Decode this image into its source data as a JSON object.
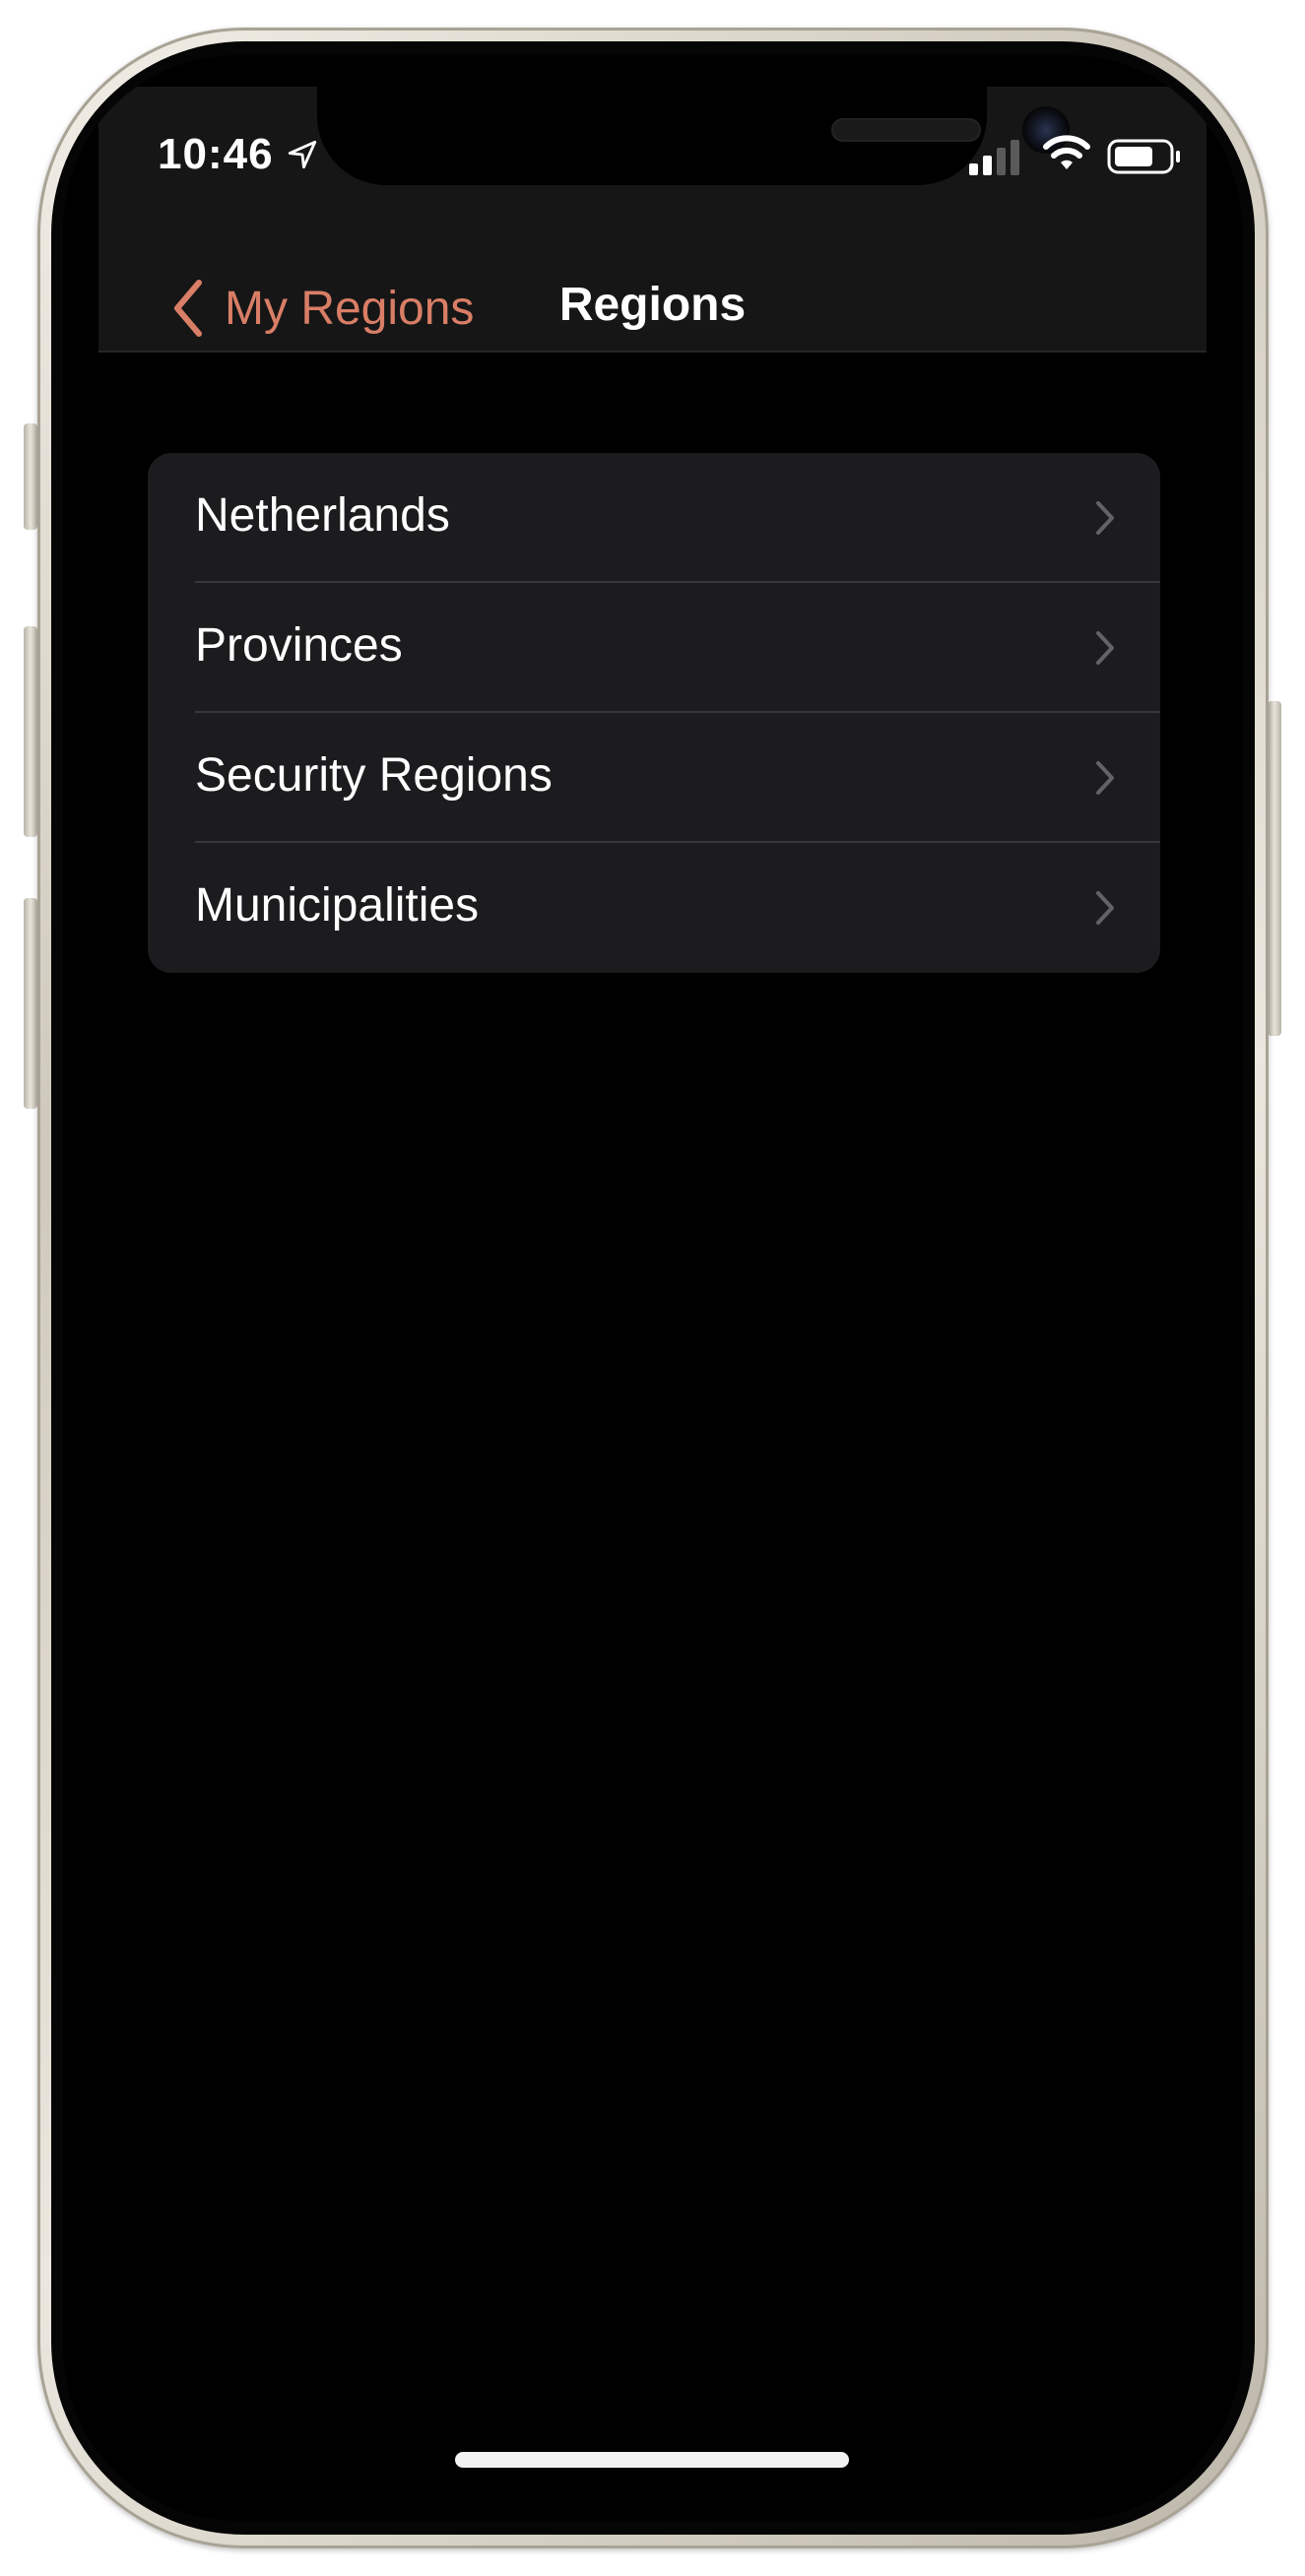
{
  "status_bar": {
    "time": "10:46",
    "icons": [
      "location-arrow-icon",
      "cellular-signal-icon",
      "wifi-icon",
      "battery-icon"
    ]
  },
  "nav": {
    "back_label": "My Regions",
    "title": "Regions"
  },
  "list": {
    "items": [
      {
        "label": "Netherlands"
      },
      {
        "label": "Provinces"
      },
      {
        "label": "Security Regions"
      },
      {
        "label": "Municipalities"
      }
    ]
  },
  "colors": {
    "accent": "#d97e66",
    "background": "#000000",
    "card": "#1c1c1e",
    "separator": "#38383a",
    "frame": "#e7e3da"
  }
}
